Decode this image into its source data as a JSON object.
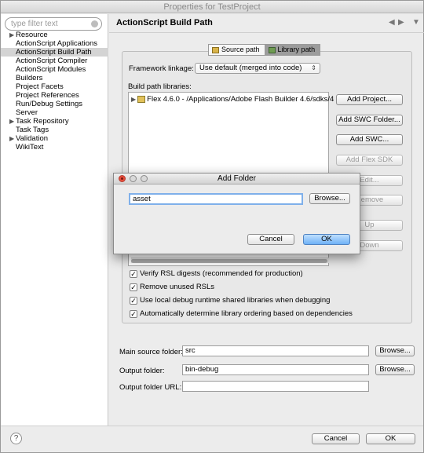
{
  "window": {
    "title": "Properties for TestProject"
  },
  "sidebar": {
    "filter_placeholder": "type filter text",
    "items": [
      {
        "label": "Resource",
        "expandable": true,
        "selected": false
      },
      {
        "label": "ActionScript Applications",
        "expandable": false,
        "selected": false
      },
      {
        "label": "ActionScript Build Path",
        "expandable": false,
        "selected": true
      },
      {
        "label": "ActionScript Compiler",
        "expandable": false,
        "selected": false
      },
      {
        "label": "ActionScript Modules",
        "expandable": false,
        "selected": false
      },
      {
        "label": "Builders",
        "expandable": false,
        "selected": false
      },
      {
        "label": "Project Facets",
        "expandable": false,
        "selected": false
      },
      {
        "label": "Project References",
        "expandable": false,
        "selected": false
      },
      {
        "label": "Run/Debug Settings",
        "expandable": false,
        "selected": false
      },
      {
        "label": "Server",
        "expandable": false,
        "selected": false
      },
      {
        "label": "Task Repository",
        "expandable": true,
        "selected": false
      },
      {
        "label": "Task Tags",
        "expandable": false,
        "selected": false
      },
      {
        "label": "Validation",
        "expandable": true,
        "selected": false
      },
      {
        "label": "WikiText",
        "expandable": false,
        "selected": false
      }
    ]
  },
  "main": {
    "title": "ActionScript Build Path",
    "tabs": [
      {
        "label": "Source path",
        "active": false
      },
      {
        "label": "Library path",
        "active": true
      }
    ],
    "framework_linkage_label": "Framework linkage:",
    "framework_linkage_value": "Use default (merged into code)",
    "build_path_label": "Build path libraries:",
    "libraries": [
      "Flex 4.6.0 - /Applications/Adobe Flash Builder 4.6/sdks/4"
    ],
    "buttons": {
      "add_project": "Add Project...",
      "add_swc_folder": "Add SWC Folder...",
      "add_swc": "Add SWC...",
      "add_flex_sdk": "Add Flex SDK",
      "edit": "Edit...",
      "remove": "Remove",
      "up": "Up",
      "down": "Down"
    },
    "options": [
      {
        "label": "Verify RSL digests (recommended for production)",
        "checked": true
      },
      {
        "label": "Remove unused RSLs",
        "checked": true
      },
      {
        "label": "Use local debug runtime shared libraries when debugging",
        "checked": true
      },
      {
        "label": "Automatically determine library ordering based on dependencies",
        "checked": true
      }
    ],
    "main_source_folder_label": "Main source folder:",
    "main_source_folder_value": "src",
    "output_folder_label": "Output folder:",
    "output_folder_value": "bin-debug",
    "output_folder_url_label": "Output folder URL:",
    "output_folder_url_value": "",
    "browse_label": "Browse..."
  },
  "footer": {
    "cancel": "Cancel",
    "ok": "OK",
    "help_icon": "?"
  },
  "dialog": {
    "title": "Add Folder",
    "input_value": "asset",
    "browse": "Browse...",
    "cancel": "Cancel",
    "ok": "OK"
  }
}
